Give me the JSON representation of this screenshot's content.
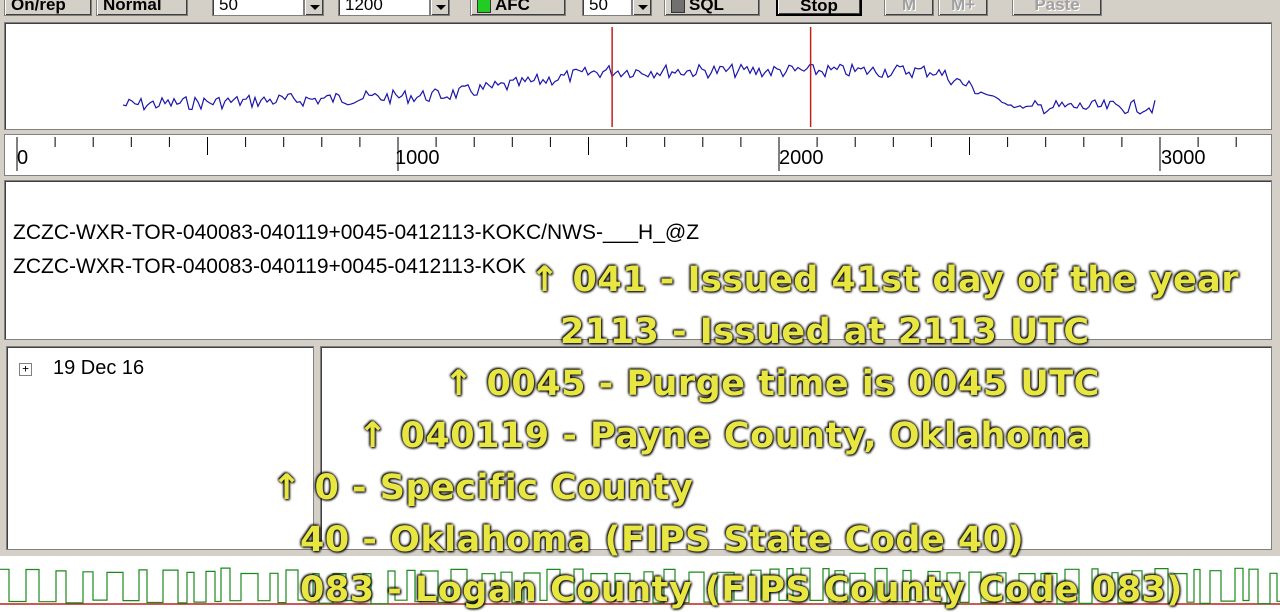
{
  "toolbar": {
    "onrep_label": "On/rep",
    "mode_label": "Normal",
    "combo1_value": "50",
    "combo2_value": "1200",
    "afc_label": "AFC",
    "combo3_value": "50",
    "sql_label": "SQL",
    "stop_label": "Stop",
    "m_label": "M",
    "mp_label": "M+",
    "fast_label": "Paste",
    "afc_led_color": "#22cc22",
    "sql_led_color": "#707070"
  },
  "spectrum": {
    "trace_color": "#1a14a8",
    "marker_color": "#c0201c",
    "markers_hz": [
      1562,
      2083
    ]
  },
  "ruler": {
    "labels": [
      "0",
      "1000",
      "2000",
      "3000"
    ]
  },
  "decode": {
    "line1": "ZCZC-WXR-TOR-040083-040119+0045-0412113-KOKC/NWS-___H_@Z",
    "line2": "ZCZC-WXR-TOR-040083-040119+0045-0412113-KOK"
  },
  "tree": {
    "expand_symbol": "+",
    "item_label": "19 Dec 16"
  },
  "annotations": [
    "↑ 041 - Issued 41st day of the year",
    "2113 - Issued at 2113 UTC",
    "↑ 0045 - Purge time is 0045 UTC",
    "↑ 040119 - Payne County, Oklahoma",
    "↑ 0 - Specific County",
    "40 - Oklahoma (FIPS State Code 40)",
    "083 - Logan County (FIPS County Code 083)"
  ],
  "overlay_color": "#e8e640"
}
